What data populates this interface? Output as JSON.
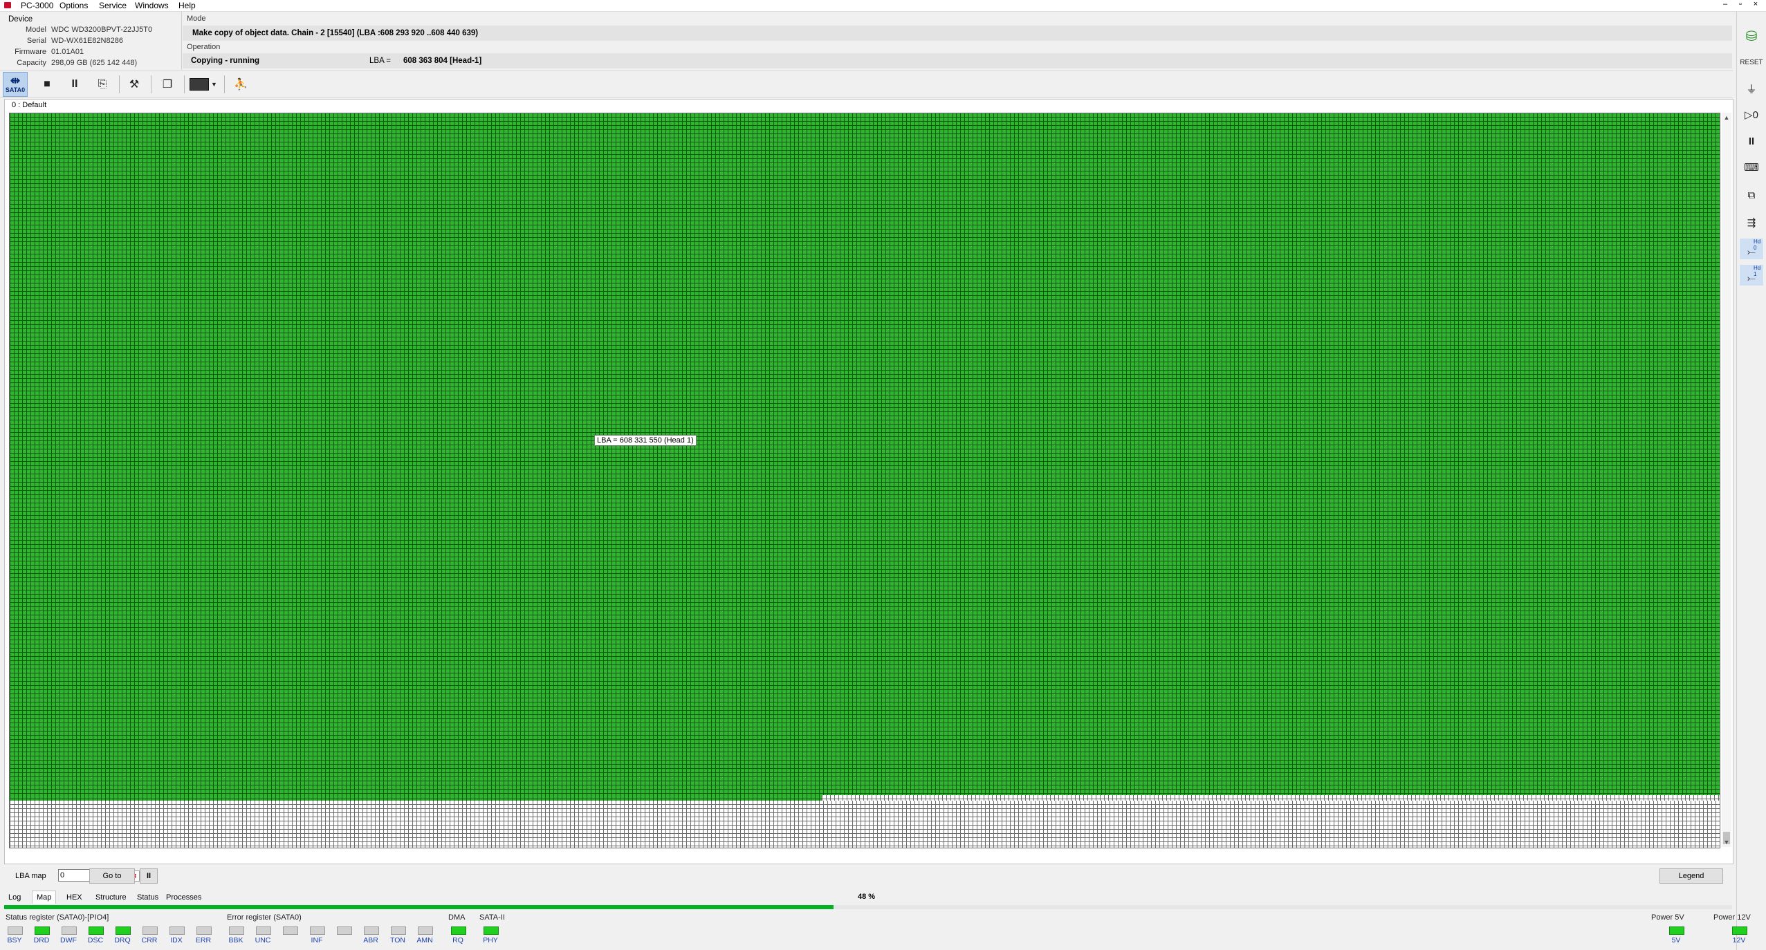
{
  "menubar": {
    "app_title": "PC-3000",
    "items": [
      "Options",
      "Service",
      "Windows",
      "Help"
    ]
  },
  "device": {
    "header": "Device",
    "model_label": "Model",
    "model": "WDC WD3200BPVT-22JJ5T0",
    "serial_label": "Serial",
    "serial": "WD-WX61E82N8286",
    "firmware_label": "Firmware",
    "firmware": "01.01A01",
    "capacity_label": "Capacity",
    "capacity": "298,09 GB (625 142 448)"
  },
  "mode": {
    "header": "Mode",
    "text": "Make copy of object data. Chain - 2 [15540] (LBA :608 293 920 ..608 440 639)"
  },
  "operation": {
    "header": "Operation",
    "status": "Copying - running",
    "lba_label": "LBA =",
    "lba_value": "608 363 804  [Head-1]"
  },
  "toolbar": {
    "sata_label": "SATA0",
    "buttons": [
      "stop-icon",
      "pause-icon",
      "export-icon",
      "tools-icon",
      "copy-windows-icon",
      "drive-icon",
      "run-icon"
    ]
  },
  "map": {
    "title": "0 : Default",
    "tooltip": "LBA =  608 331 550 (Head 1)",
    "completed_fraction": 0.48,
    "colors": {
      "done": "#2fb52f",
      "pending": "#ffffff",
      "grid_line": "#0f5a0f"
    }
  },
  "lba_map": {
    "label": "LBA map",
    "value": "0",
    "goto_label": "Go to",
    "pause_glyph": "II",
    "legend_label": "Legend"
  },
  "tabs": {
    "items": [
      "Log",
      "Map",
      "HEX",
      "Structure",
      "Status",
      "Processes"
    ],
    "active": "Map",
    "progress_text": "48 %",
    "progress_fraction": 0.48
  },
  "status_register": {
    "title": "Status register (SATA0)-[PIO4]",
    "leds": [
      {
        "label": "BSY",
        "on": false
      },
      {
        "label": "DRD",
        "on": true
      },
      {
        "label": "DWF",
        "on": false
      },
      {
        "label": "DSC",
        "on": true
      },
      {
        "label": "DRQ",
        "on": true
      },
      {
        "label": "CRR",
        "on": false
      },
      {
        "label": "IDX",
        "on": false
      },
      {
        "label": "ERR",
        "on": false
      }
    ]
  },
  "error_register": {
    "title": "Error register (SATA0)",
    "leds": [
      {
        "label": "BBK",
        "on": false
      },
      {
        "label": "UNC",
        "on": false
      },
      {
        "label": "",
        "on": false
      },
      {
        "label": "INF",
        "on": false
      },
      {
        "label": "",
        "on": false
      },
      {
        "label": "ABR",
        "on": false
      },
      {
        "label": "TON",
        "on": false
      },
      {
        "label": "AMN",
        "on": false
      }
    ]
  },
  "dma": {
    "title": "DMA",
    "label": "RQ",
    "on": true
  },
  "sata2": {
    "title": "SATA-II",
    "label": "PHY",
    "on": true
  },
  "power5": {
    "title": "Power 5V",
    "label": "5V",
    "on": true
  },
  "power12": {
    "title": "Power 12V",
    "label": "12V",
    "on": true
  },
  "rightbar": {
    "hd0_label": "Hd 0",
    "hd1_label": "Hd 1"
  }
}
